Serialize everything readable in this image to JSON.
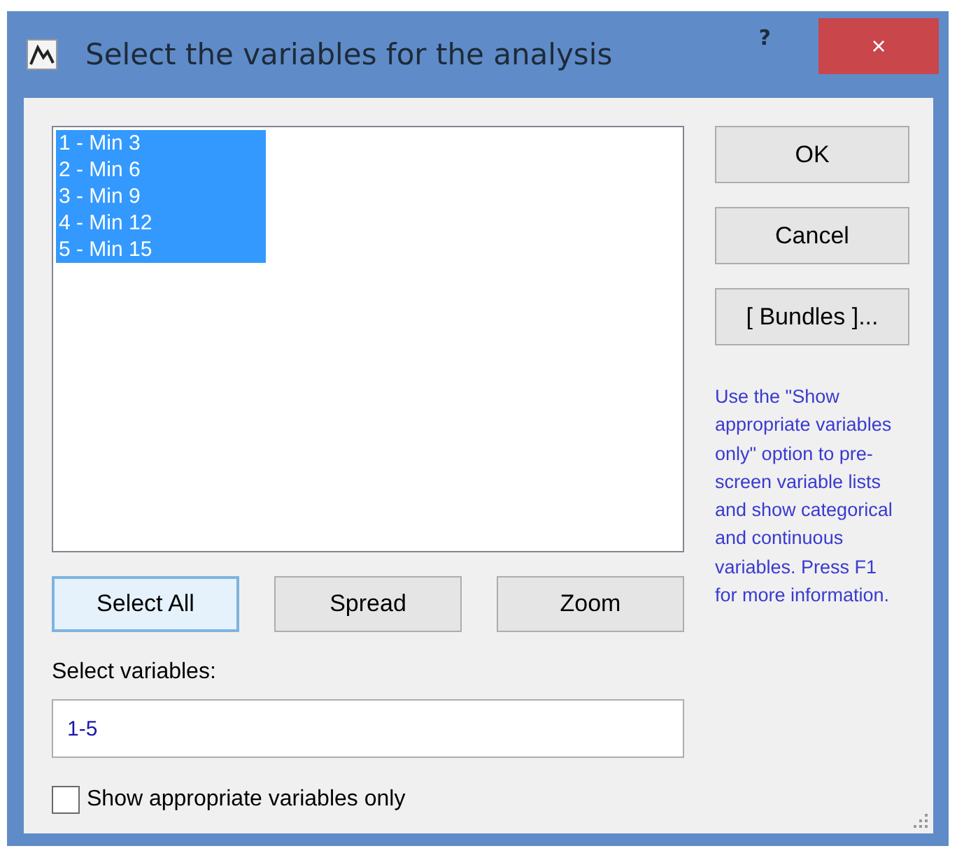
{
  "window": {
    "title": "Select the variables for the analysis",
    "help": "?",
    "close": "×"
  },
  "variables": [
    {
      "label": "1 - Min 3",
      "selected": true
    },
    {
      "label": "2 - Min 6",
      "selected": true
    },
    {
      "label": "3 - Min 9",
      "selected": true
    },
    {
      "label": "4 - Min 12",
      "selected": true
    },
    {
      "label": "5 - Min 15",
      "selected": true
    }
  ],
  "side_buttons": [
    "OK",
    "Cancel",
    "[ Bundles ]..."
  ],
  "help_text": "Use the \"Show appropriate variables only\" option to pre-screen variable lists and show categorical and continuous variables. Press F1 for more information.",
  "list_buttons": [
    {
      "label": "Select All",
      "focused": true
    },
    {
      "label": "Spread",
      "focused": false
    },
    {
      "label": "Zoom",
      "focused": false
    }
  ],
  "select_label": "Select variables:",
  "select_field": {
    "value": "1-5"
  },
  "show_appropriate": {
    "label": "Show appropriate variables only",
    "checked": false
  }
}
